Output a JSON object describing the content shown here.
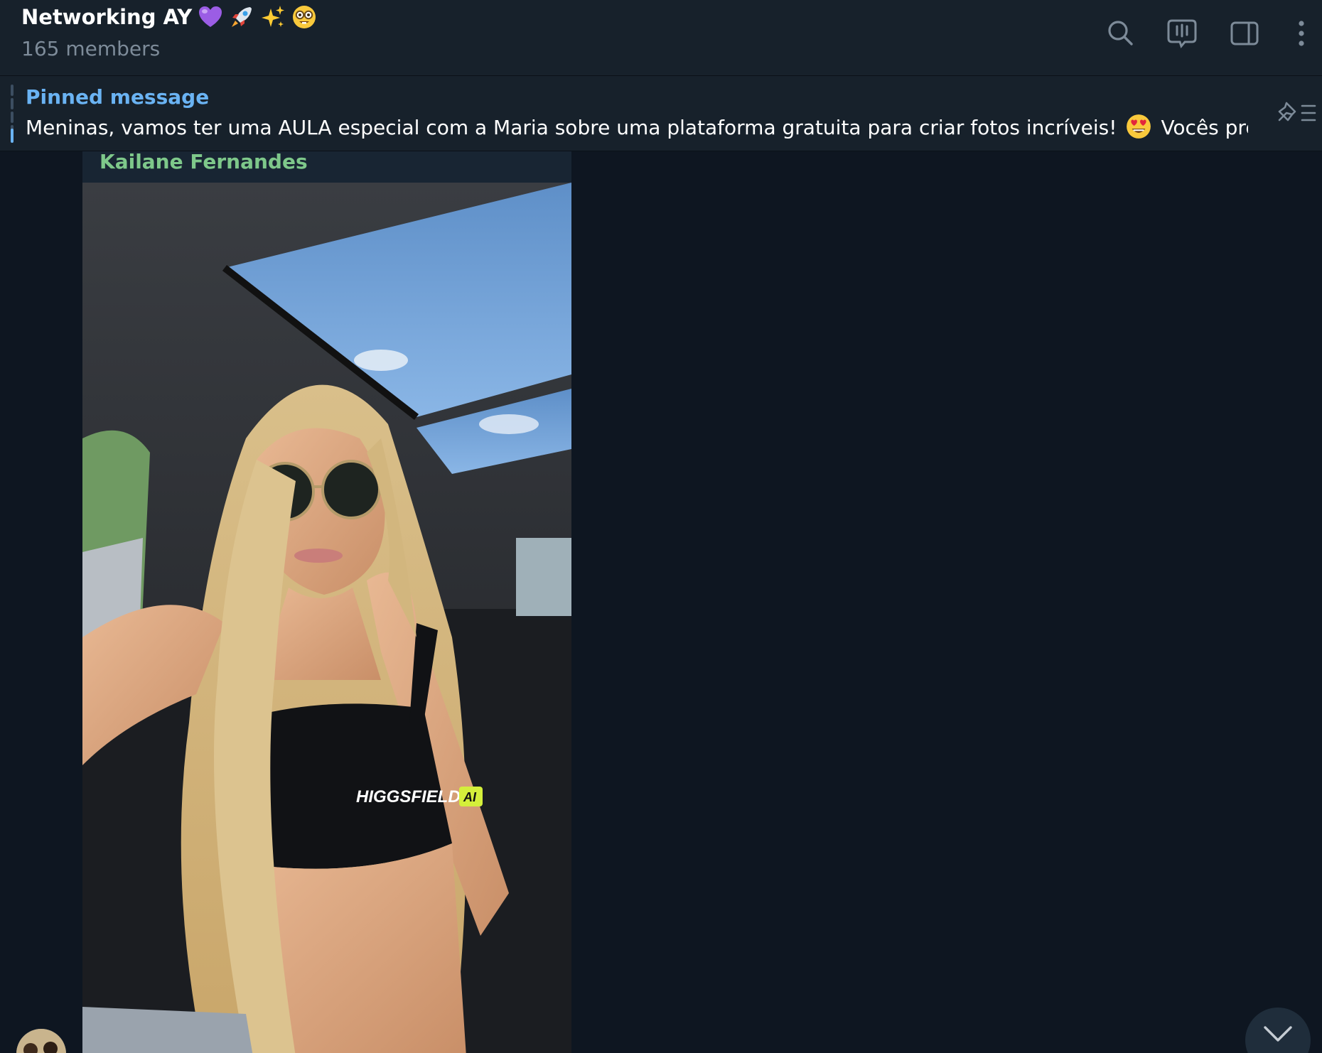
{
  "chat": {
    "title": "Networking AY",
    "title_emojis": [
      "purple-heart-emoji",
      "rocket-emoji",
      "sparkles-emoji",
      "nerd-face-emoji"
    ],
    "members": "165 members"
  },
  "header_actions": [
    "search-icon",
    "live-stream-icon",
    "sidebar-toggle-icon",
    "more-vertical-icon"
  ],
  "pinned": {
    "title": "Pinned message",
    "text_before": "Meninas, vamos ter uma AULA especial com a Maria  sobre uma plataforma gratuita para criar fotos incríveis!",
    "emoji": "heart-eyes-emoji",
    "text_after": "Vocês precisam..."
  },
  "message": {
    "sender": "Kailane Fernandes",
    "photo_watermark": "HIGGSFIELD",
    "photo_watermark_badge": "AI"
  },
  "colors": {
    "header_bg": "#17212b",
    "chat_bg": "#0e1621",
    "accent": "#6ab3f3",
    "sender_name": "#7ec88a",
    "muted_text": "#7d8b99"
  }
}
